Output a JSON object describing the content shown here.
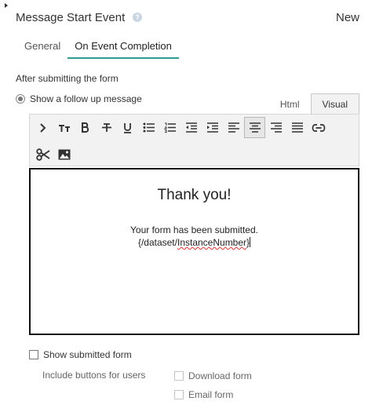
{
  "header": {
    "title": "Message Start Event",
    "status": "New"
  },
  "tabs": [
    {
      "label": "General"
    },
    {
      "label": "On Event Completion"
    }
  ],
  "section": {
    "label": "After submitting the form"
  },
  "follow_up": {
    "label": "Show a follow up message",
    "selected": true
  },
  "view_tabs": [
    {
      "label": "Html"
    },
    {
      "label": "Visual"
    }
  ],
  "toolbar": {
    "row1": [
      "expand-icon",
      "text-size-icon",
      "bold-icon",
      "strikethrough-icon",
      "underline-icon",
      "bulleted-list-icon",
      "numbered-list-icon",
      "outdent-icon",
      "indent-icon",
      "align-left-icon",
      "align-center-icon",
      "align-right-icon",
      "justify-icon",
      "link-icon"
    ],
    "row2": [
      "scissors-icon",
      "image-icon"
    ],
    "selected": "align-center-icon"
  },
  "editor": {
    "heading": "Thank you!",
    "line1": "Your form has been submitted.",
    "line2_prefix": "{/dataset/",
    "line2_misspelled": "InstanceNumber",
    "line2_suffix": "}"
  },
  "options": {
    "show_submitted_form": "Show submitted form",
    "include_buttons": "Include buttons for users",
    "download_form": "Download form",
    "email_form": "Email form"
  }
}
